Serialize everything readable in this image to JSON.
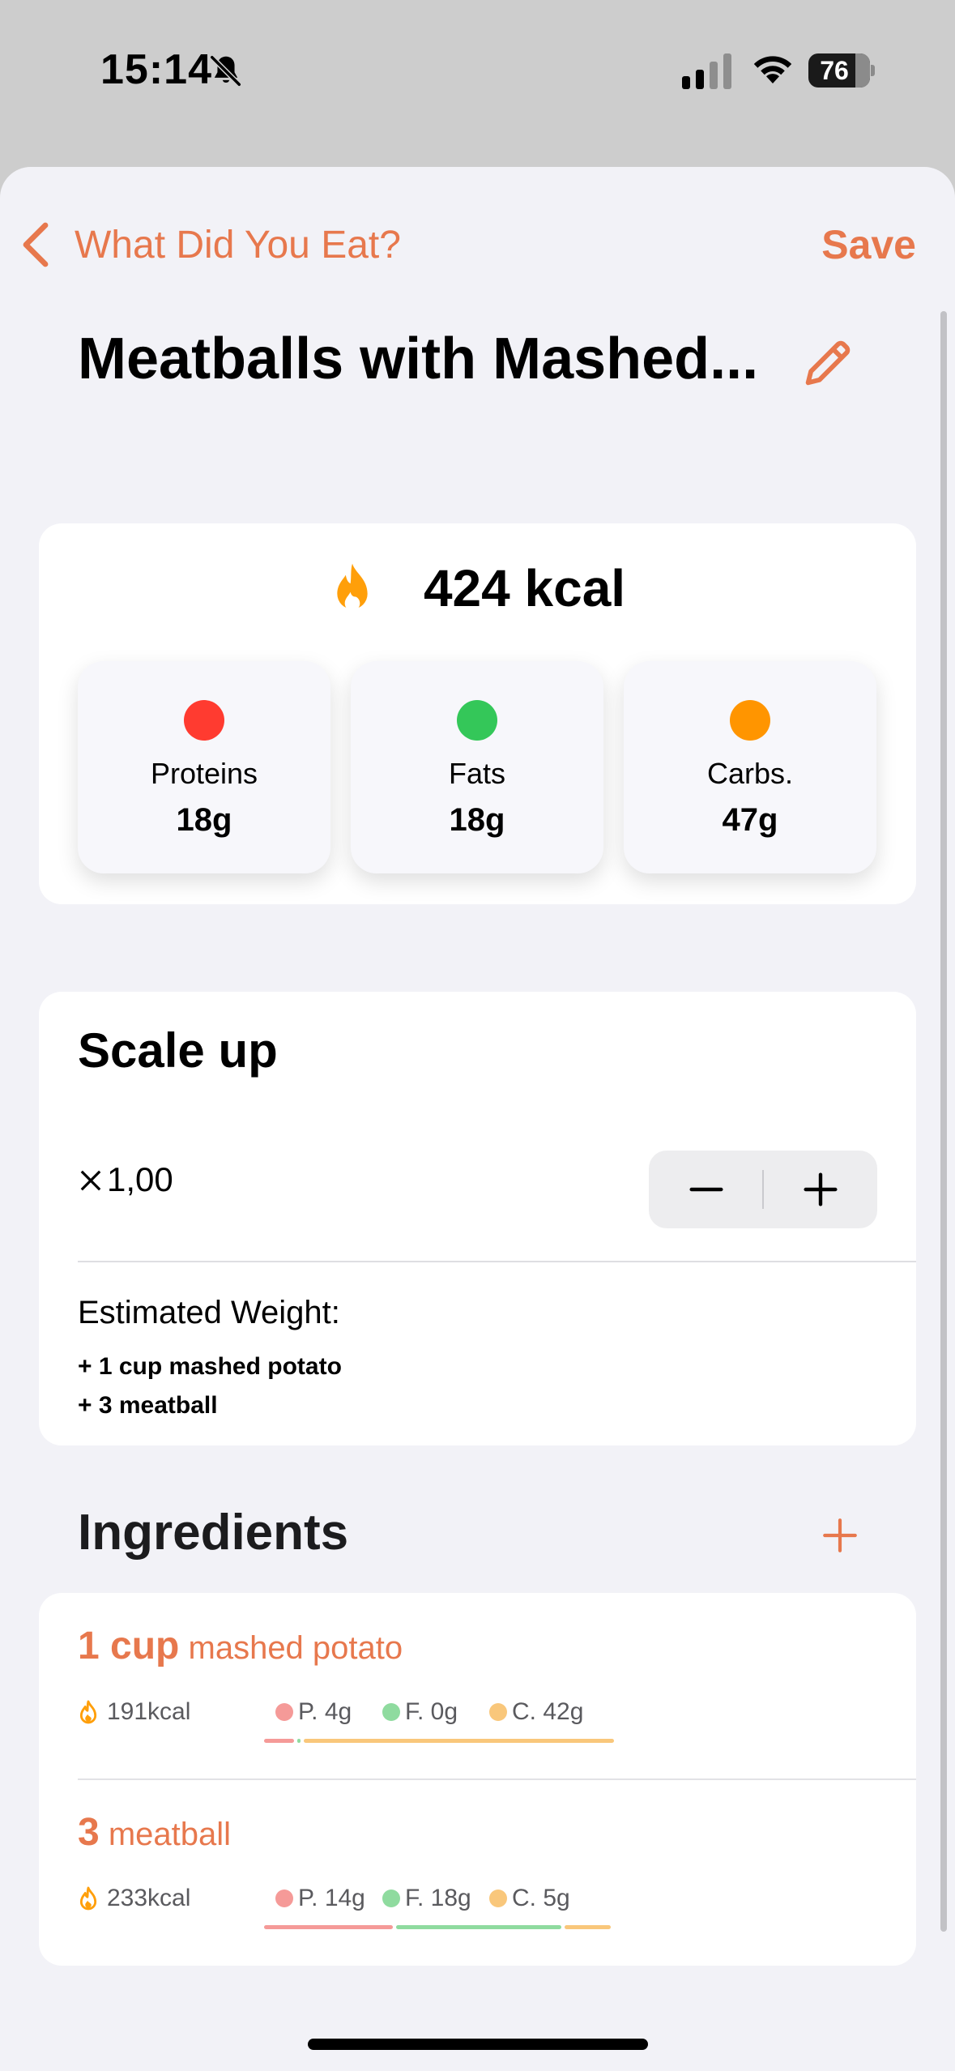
{
  "status_bar": {
    "time": "15:14",
    "battery_level": "76",
    "battery_fraction": 0.76
  },
  "nav": {
    "back_label": "What Did You Eat?",
    "save_label": "Save"
  },
  "meal": {
    "title": "Meatballs with Mashed..."
  },
  "nutrition": {
    "kcal": "424 kcal",
    "macros": [
      {
        "name": "Proteins",
        "value": "18g",
        "color": "#ff3b30"
      },
      {
        "name": "Fats",
        "value": "18g",
        "color": "#34c759"
      },
      {
        "name": "Carbs.",
        "value": "47g",
        "color": "#ff9500"
      }
    ]
  },
  "scale": {
    "title": "Scale up",
    "multiplier": "1,00",
    "weight_label": "Estimated Weight:",
    "weight_items": [
      "+ 1 cup mashed potato",
      "+ 3 meatball"
    ]
  },
  "ingredients": {
    "title": "Ingredients",
    "items": [
      {
        "qty": "1 cup",
        "name": "mashed potato",
        "kcal": "191kcal",
        "protein": "P. 4g",
        "fat": "F. 0g",
        "carbs": "C. 42g",
        "protein_g": 4,
        "fat_g": 0,
        "carbs_g": 42
      },
      {
        "qty": "3",
        "name": "meatball",
        "kcal": "233kcal",
        "protein": "P. 14g",
        "fat": "F. 18g",
        "carbs": "C. 5g",
        "protein_g": 14,
        "fat_g": 18,
        "carbs_g": 5
      }
    ]
  },
  "colors": {
    "accent": "#e7784d",
    "protein_light": "#f59a98",
    "fat_light": "#8fdb9f",
    "carbs_light": "#f9c77b"
  }
}
